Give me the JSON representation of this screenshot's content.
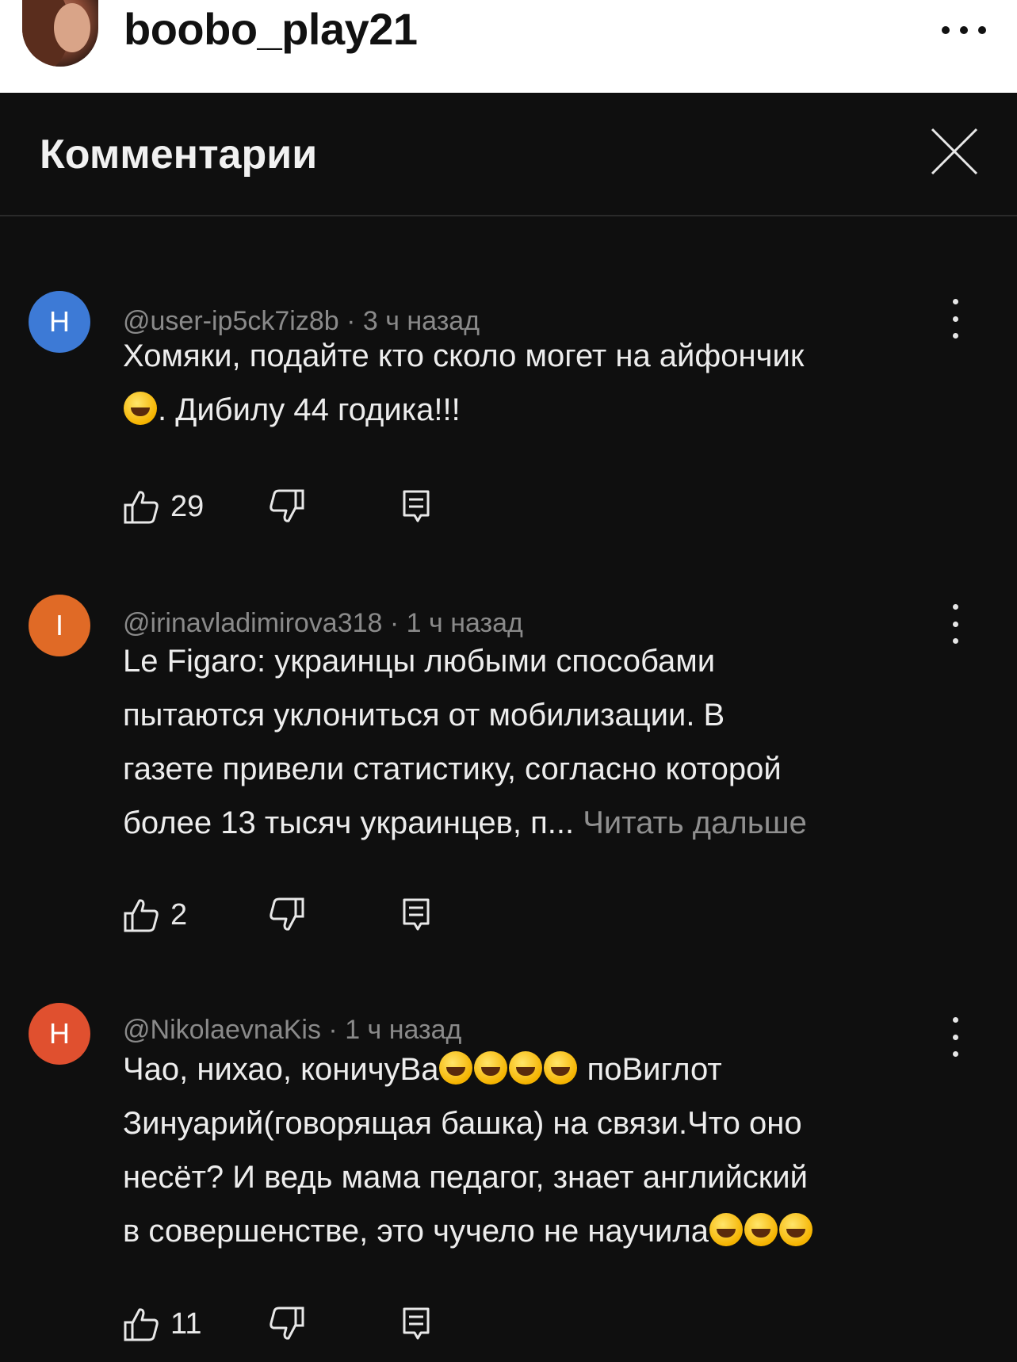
{
  "instagram": {
    "username": "boobo_play21"
  },
  "panel": {
    "title": "Комментарии"
  },
  "comments": [
    {
      "avatar_letter": "H",
      "avatar_color": "#3d7ad6",
      "author": "@user-ip5ck7iz8b",
      "time": "3 ч назад",
      "lines": [
        "Хомяки, подайте кто сколо могет на айфончик"
      ],
      "line2_after_emoji": ". Дибилу 44 годика!!!",
      "likes": "29"
    },
    {
      "avatar_letter": "I",
      "avatar_color": "#e06a26",
      "author": "@irinavladimirova318",
      "time": "1 ч назад",
      "lines": [
        "Le Figaro: украинцы любыми способами",
        "пытаются уклониться от мобилизации. В",
        "газете привели статистику, согласно которой",
        "более 13 тысяч украинцев, п..."
      ],
      "read_more": "Читать дальше",
      "likes": "2"
    },
    {
      "avatar_letter": "H",
      "avatar_color": "#e0502f",
      "author": "@NikolaevnaKis",
      "time": "1 ч назад",
      "line1_before_emoji": "Чао, нихао, коничуВа",
      "line1_after_emoji": " поВиглот",
      "lines": [
        "Зинуарий(говорящая башка)   на связи.Что оно",
        "несёт? И ведь мама педагог, знает английский"
      ],
      "line4_before_emoji": "в совершенстве, это чучело не научила",
      "likes": "11"
    }
  ]
}
